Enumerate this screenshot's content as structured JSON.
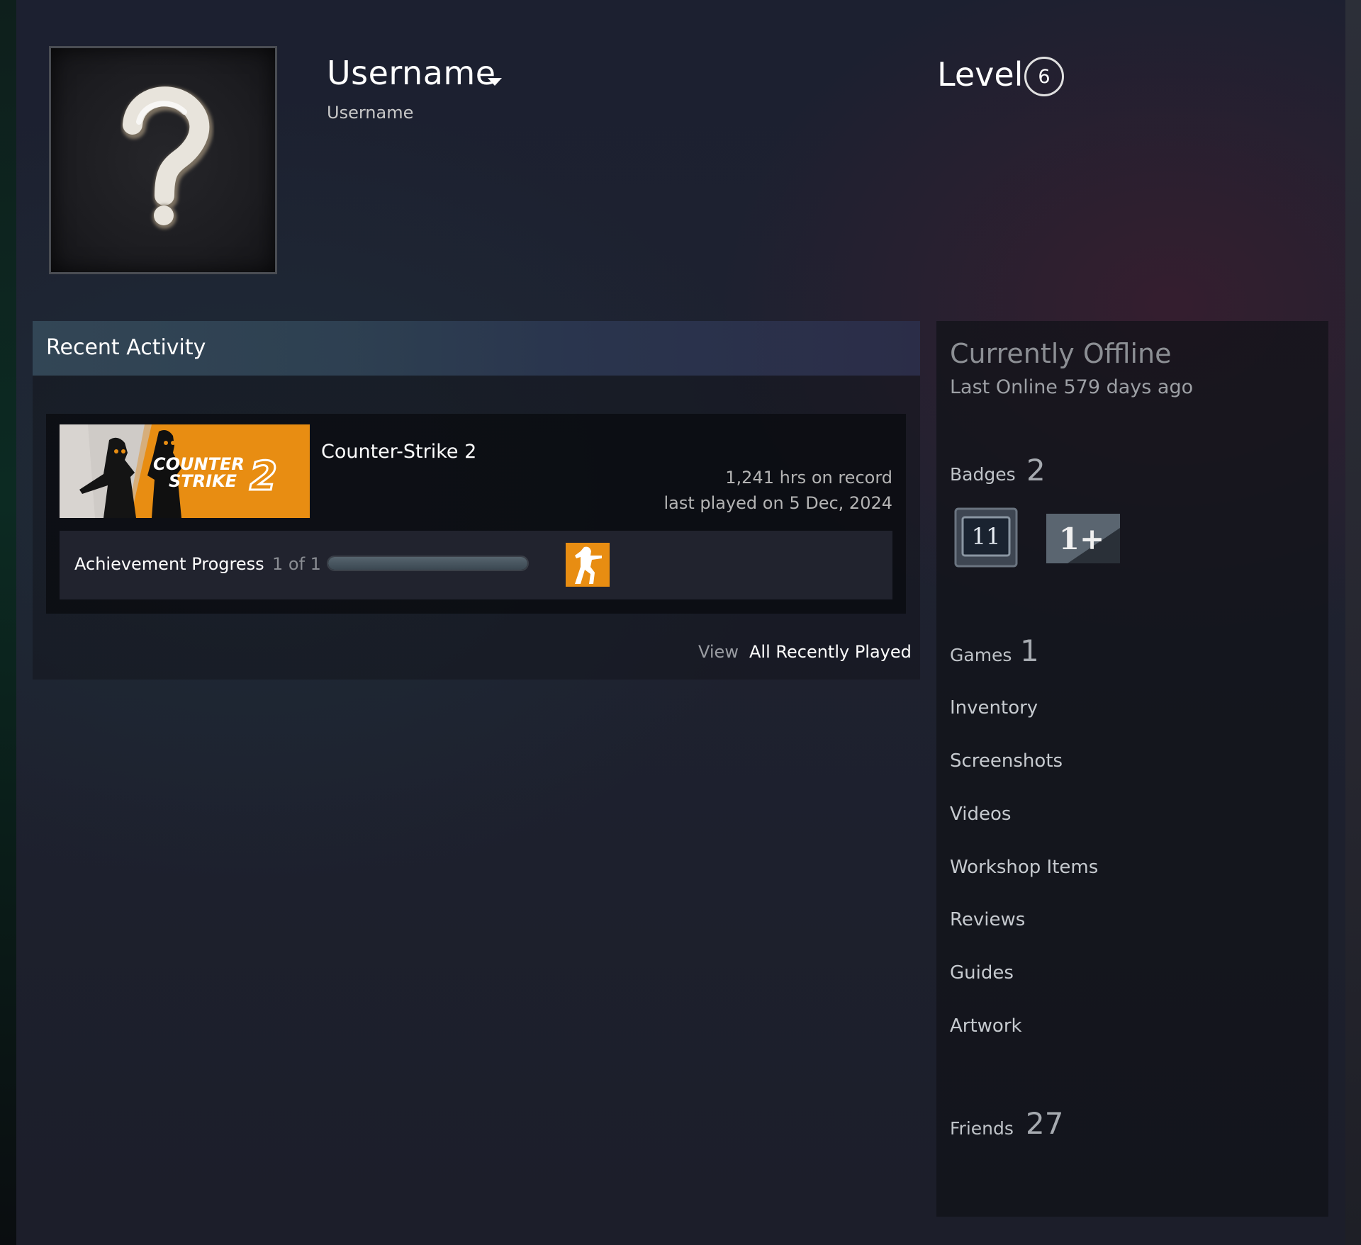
{
  "profile": {
    "persona_name": "Username",
    "real_name": "Username",
    "level_label": "Level",
    "level": "6",
    "avatar_icon": "question-mark-icon"
  },
  "recent_activity": {
    "title": "Recent Activity",
    "game": {
      "name": "Counter-Strike 2",
      "capsule_text_line1": "COUNTER",
      "capsule_text_line2": "STRIKE",
      "capsule_text_2": "2",
      "hours": "1,241 hrs on record",
      "last_played": "last played on 5 Dec, 2024",
      "achievement_label": "Achievement Progress",
      "achievement_count": "1 of 1",
      "achievement_progress": 1.0,
      "achievement_icon": "counter-terrorist-icon"
    },
    "view_label": "View",
    "view_link": "All Recently Played"
  },
  "sidebar": {
    "status": "Currently Offline",
    "last_online": "Last Online 579 days ago",
    "badges_label": "Badges",
    "badges_count": "2",
    "badge_items": [
      {
        "icon": "years-of-service-badge-icon",
        "text": "11"
      },
      {
        "icon": "one-plus-badge-icon",
        "text": "1+"
      }
    ],
    "games_label": "Games",
    "games_count": "1",
    "links": [
      "Inventory",
      "Screenshots",
      "Videos",
      "Workshop Items",
      "Reviews",
      "Guides",
      "Artwork"
    ],
    "friends_label": "Friends",
    "friends_count": "27"
  },
  "colors": {
    "accent_orange": "#e88d12",
    "text_primary": "#ffffff",
    "text_muted": "#b4b4b4"
  }
}
